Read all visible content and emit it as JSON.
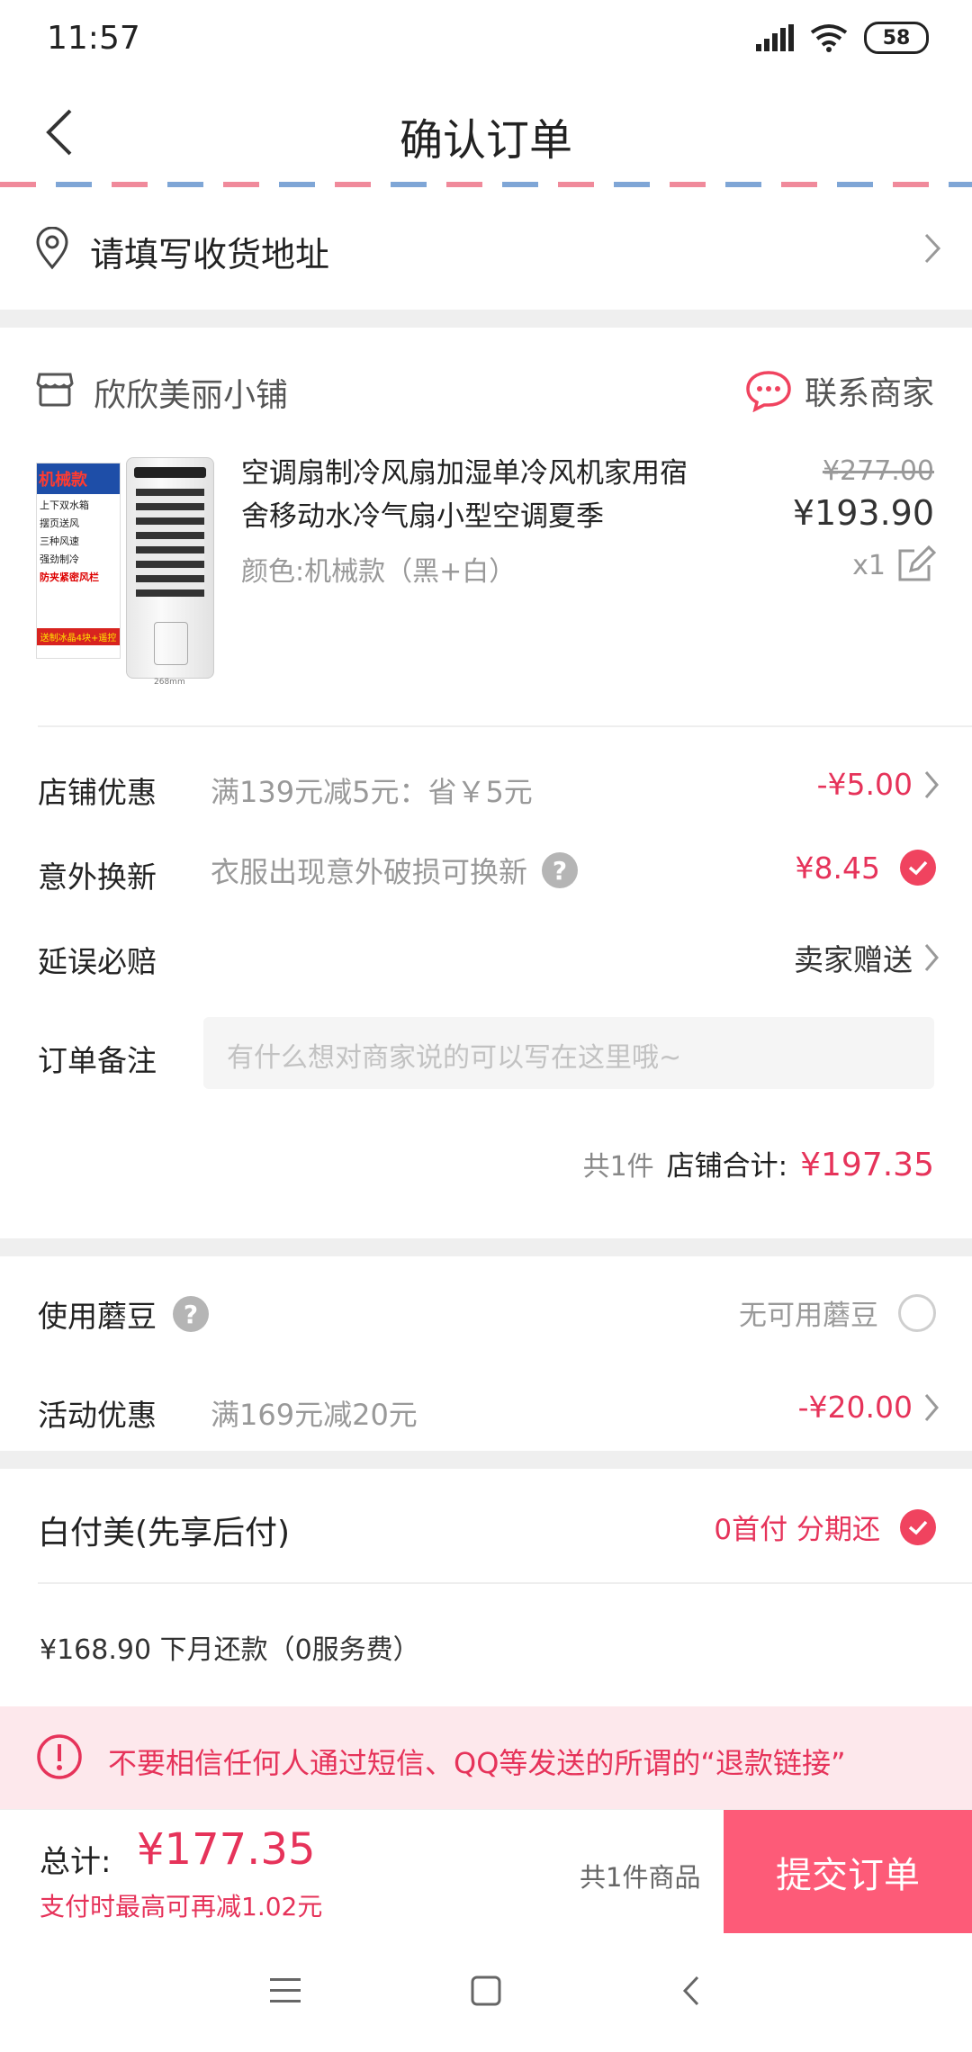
{
  "status_bar": {
    "time": "11:57",
    "battery": "58"
  },
  "header": {
    "title": "确认订单"
  },
  "address": {
    "label": "请填写收货地址"
  },
  "store": {
    "name": "欣欣美丽小铺",
    "contact_label": "联系商家",
    "product": {
      "title": "空调扇制冷风扇加湿单冷风机家用宿舍移动水冷气扇小型空调夏季",
      "variant": "颜色:机械款（黑+白）",
      "original_price": "¥277.00",
      "price": "¥193.90",
      "quantity": "x1",
      "image_tag": "机械款",
      "image_features": [
        "上下双水箱",
        "摆页送风",
        "三种风速",
        "强劲制冷",
        "防夹紧密风栏"
      ],
      "image_promo": "送制冰晶4块+遥控",
      "image_model": "268mm"
    },
    "shop_discount": {
      "label": "店铺优惠",
      "desc": "满139元减5元：省￥5元",
      "value": "-¥5.00"
    },
    "replacement": {
      "label": "意外换新",
      "desc": "衣服出现意外破损可换新",
      "value": "¥8.45"
    },
    "delay": {
      "label": "延误必赔",
      "value": "卖家赠送"
    },
    "note": {
      "label": "订单备注",
      "placeholder": "有什么想对商家说的可以写在这里哦~"
    },
    "total": {
      "count": "共1件",
      "label": "店铺合计:",
      "value": "¥197.35"
    }
  },
  "mogu_beans": {
    "label": "使用蘑豆",
    "value": "无可用蘑豆"
  },
  "promotion": {
    "label": "活动优惠",
    "desc": "满169元减20元",
    "value": "-¥20.00"
  },
  "baifumei": {
    "label": "白付美(先享后付)",
    "value": "0首付 分期还",
    "detail": "¥168.90 下月还款（0服务费）"
  },
  "warning": {
    "text": "不要相信任何人通过短信、QQ等发送的所谓的“退款链接”"
  },
  "bottom": {
    "total_label": "总计:",
    "total_value": "¥177.35",
    "note": "支付时最高可再减1.02元",
    "count": "共1件商品",
    "submit": "提交订单"
  },
  "colors": {
    "accent": "#e6335a",
    "submit_bg": "#fd5b78",
    "check": "#f0435f"
  }
}
